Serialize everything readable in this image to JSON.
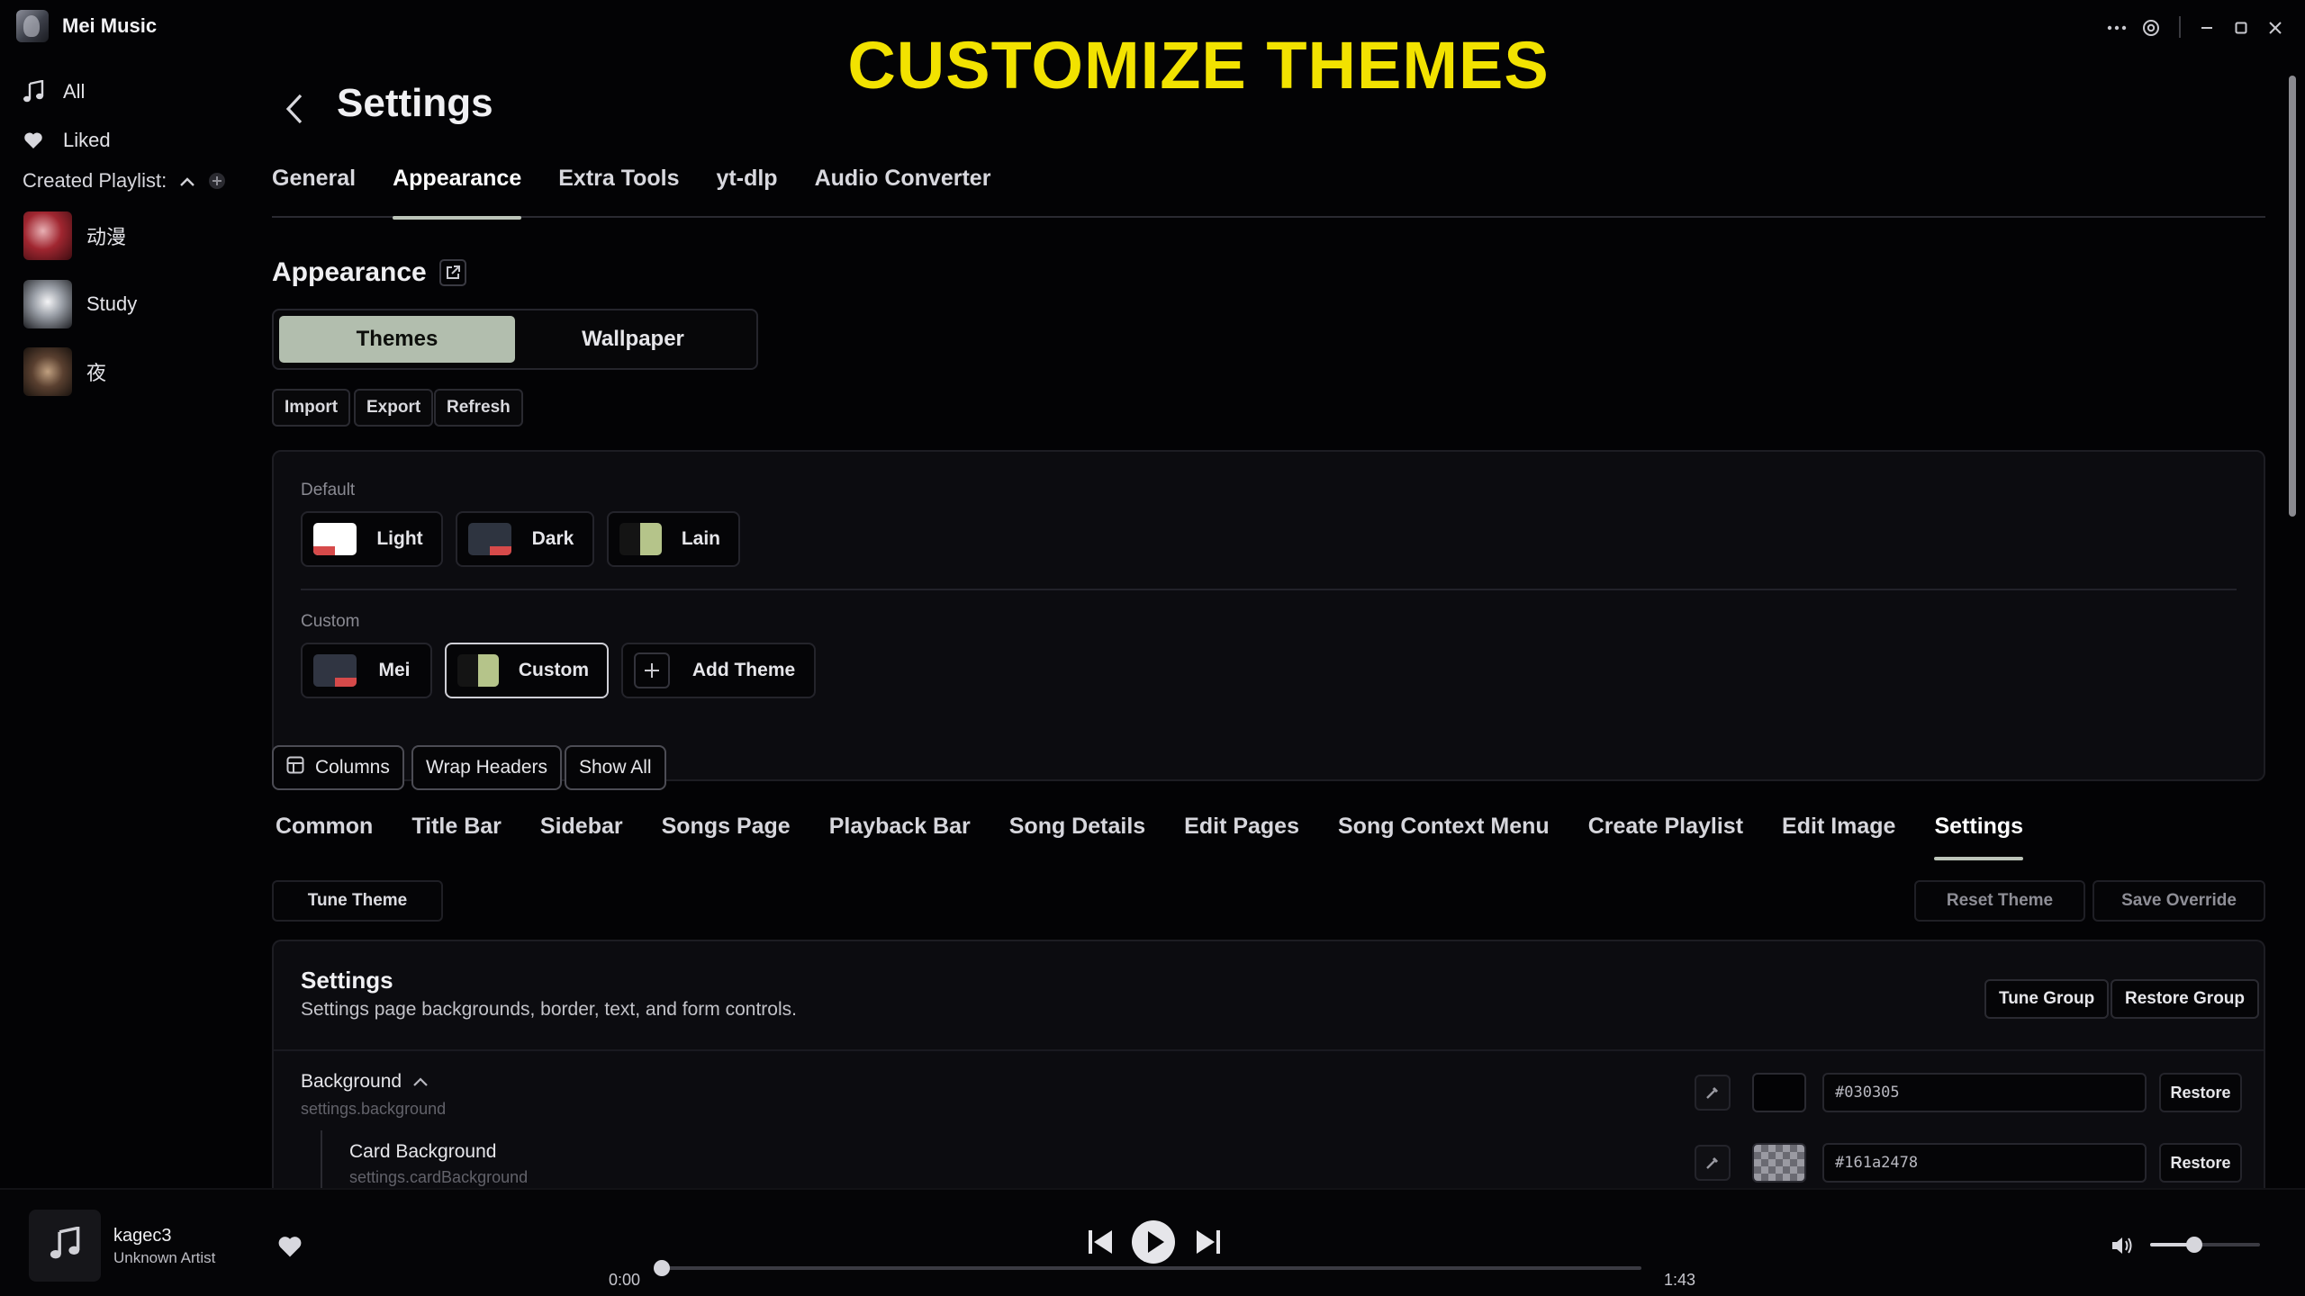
{
  "app": {
    "title": "Mei Music",
    "promo_banner": "CUSTOMIZE THEMES"
  },
  "window_controls": [
    "more-icon",
    "settings-gear-icon",
    "minimize-icon",
    "maximize-icon",
    "close-icon"
  ],
  "sidebar": {
    "items": [
      {
        "label": "All",
        "icon": "music-note-icon"
      },
      {
        "label": "Liked",
        "icon": "heart-icon"
      }
    ],
    "section_label": "Created Playlist:",
    "playlists": [
      {
        "label": "动漫"
      },
      {
        "label": "Study"
      },
      {
        "label": "夜"
      }
    ]
  },
  "settings": {
    "title": "Settings",
    "tabs": [
      {
        "label": "General",
        "active": false
      },
      {
        "label": "Appearance",
        "active": true
      },
      {
        "label": "Extra Tools",
        "active": false
      },
      {
        "label": "yt-dlp",
        "active": false
      },
      {
        "label": "Audio Converter",
        "active": false
      }
    ],
    "appearance": {
      "title": "Appearance",
      "segments": [
        {
          "label": "Themes",
          "active": true
        },
        {
          "label": "Wallpaper",
          "active": false
        }
      ],
      "file_actions": [
        "Import",
        "Export",
        "Refresh"
      ],
      "default_label": "Default",
      "default_themes": [
        {
          "label": "Light",
          "swatch_bg": "#ffffff",
          "swatch_accent": "#d64a4a"
        },
        {
          "label": "Dark",
          "swatch_bg": "#2e3440",
          "swatch_accent": "#d64a4a"
        },
        {
          "label": "Lain",
          "swatch_bg": "#141414",
          "swatch_accent": "#b5c48a"
        }
      ],
      "custom_label": "Custom",
      "custom_themes": [
        {
          "label": "Mei",
          "swatch_bg": "#303542",
          "swatch_accent": "#d64a4a",
          "selected": false
        },
        {
          "label": "Custom",
          "swatch_bg": "#141414",
          "swatch_accent": "#b5c48a",
          "selected": true
        }
      ],
      "add_theme_label": "Add Theme",
      "table_tools": [
        "Columns",
        "Wrap Headers",
        "Show All"
      ],
      "subtabs": [
        {
          "label": "Common",
          "active": false
        },
        {
          "label": "Title Bar",
          "active": false
        },
        {
          "label": "Sidebar",
          "active": false
        },
        {
          "label": "Songs Page",
          "active": false
        },
        {
          "label": "Playback Bar",
          "active": false
        },
        {
          "label": "Song Details",
          "active": false
        },
        {
          "label": "Edit Pages",
          "active": false
        },
        {
          "label": "Song Context Menu",
          "active": false
        },
        {
          "label": "Create Playlist",
          "active": false
        },
        {
          "label": "Edit Image",
          "active": false
        },
        {
          "label": "Settings",
          "active": true
        }
      ],
      "tune_theme_label": "Tune Theme",
      "reset_theme_label": "Reset Theme",
      "save_override_label": "Save Override",
      "group": {
        "title": "Settings",
        "description": "Settings page backgrounds, border, text, and form controls.",
        "tune_group_label": "Tune Group",
        "restore_group_label": "Restore Group",
        "rows": [
          {
            "label": "Background",
            "key": "settings.background",
            "value": "#030305",
            "restore_label": "Restore"
          },
          {
            "label": "Card Background",
            "key": "settings.cardBackground",
            "value": "#161a2478",
            "restore_label": "Restore"
          }
        ]
      }
    }
  },
  "player": {
    "title": "kagec3",
    "artist": "Unknown Artist",
    "current_time": "0:00",
    "duration": "1:43",
    "progress": 0.0,
    "volume": 0.4
  }
}
